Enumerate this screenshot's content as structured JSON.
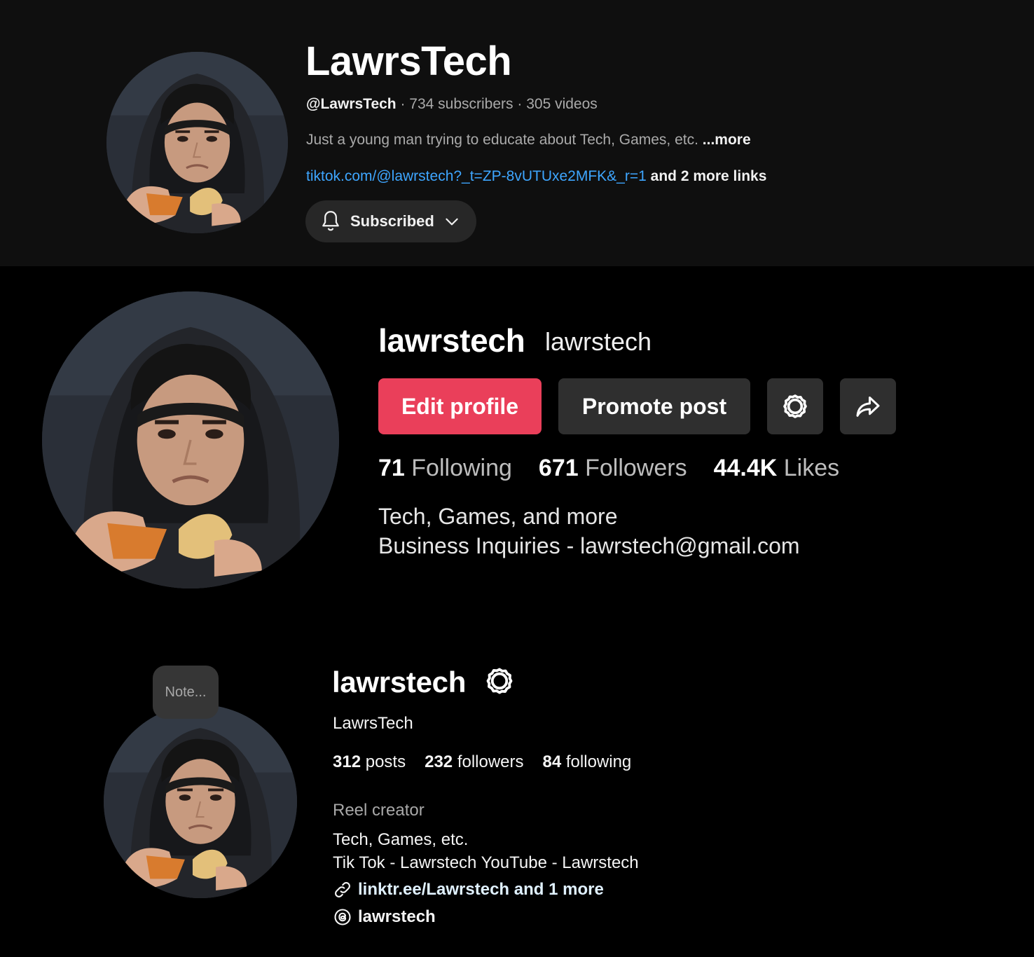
{
  "youtube": {
    "channel_name": "LawrsTech",
    "handle": "@LawrsTech",
    "subscribers": "734 subscribers",
    "videos": "305 videos",
    "separator": " · ",
    "description": "Just a young man trying to educate about Tech, Games, etc.",
    "more_label": "...more",
    "link": "tiktok.com/@lawrstech?_t=ZP-8vUTUxe2MFK&_r=1",
    "more_links": "and 2 more links",
    "subscribed_label": "Subscribed"
  },
  "tiktok": {
    "username": "lawrstech",
    "nickname": "lawrstech",
    "edit_label": "Edit profile",
    "promote_label": "Promote post",
    "stats": {
      "following_count": "71",
      "following_label": "Following",
      "followers_count": "671",
      "followers_label": "Followers",
      "likes_count": "44.4K",
      "likes_label": "Likes"
    },
    "bio_line1": "Tech, Games, and more",
    "bio_line2": "Business Inquiries - lawrstech@gmail.com"
  },
  "instagram": {
    "note_label": "Note...",
    "username": "lawrstech",
    "full_name": "LawrsTech",
    "posts_count": "312",
    "posts_label": "posts",
    "followers_count": "232",
    "followers_label": "followers",
    "following_count": "84",
    "following_label": "following",
    "category": "Reel creator",
    "bio_line1": "Tech, Games, etc.",
    "bio_line2": "Tik Tok - Lawrstech YouTube - Lawrstech",
    "link": "linktr.ee/Lawrstech and 1 more",
    "threads": "lawrstech"
  },
  "icons": [
    "bell-icon",
    "chevron-down-icon",
    "gear-icon",
    "share-icon",
    "link-icon",
    "threads-icon"
  ],
  "colors": {
    "youtube_bg": "#0f0f0f",
    "youtube_link": "#3ea6ff",
    "tiktok_accent": "#ea3f5a",
    "button_dark": "#2f2f2f"
  }
}
